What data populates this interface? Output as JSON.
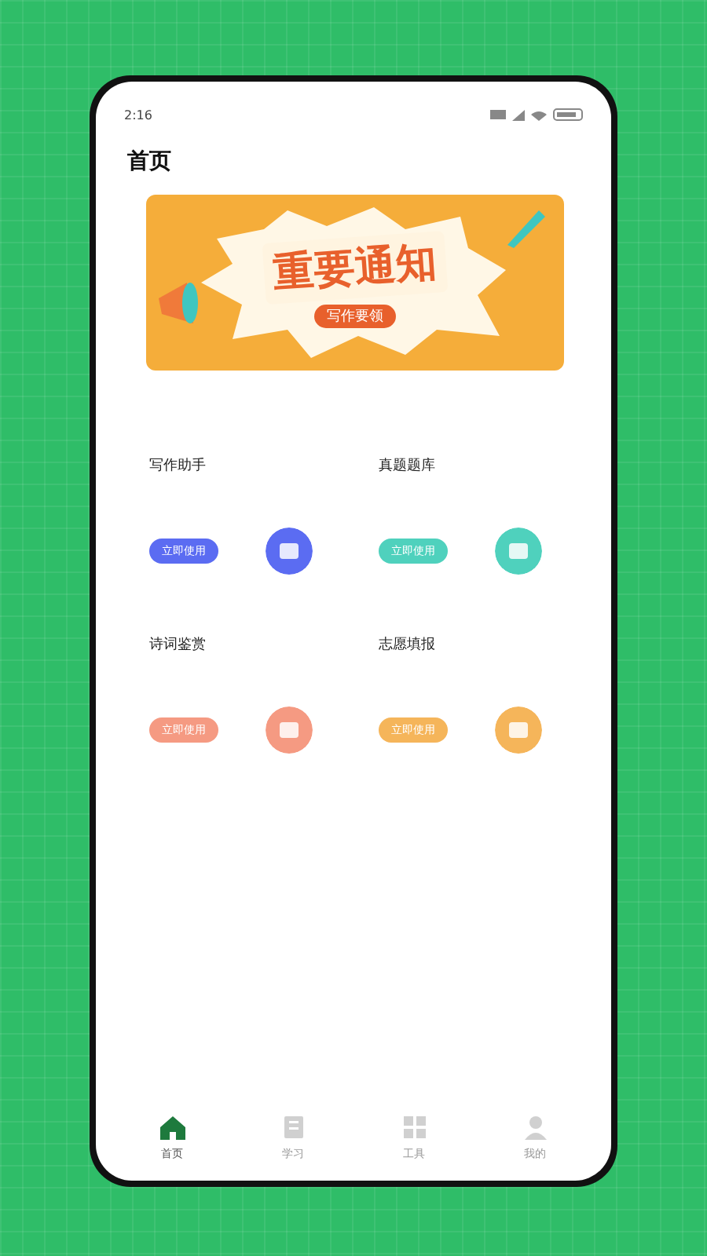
{
  "status_bar": {
    "time": "2:16"
  },
  "page": {
    "title": "首页"
  },
  "banner": {
    "headline": "重要通知",
    "subtitle": "写作要领"
  },
  "tools": [
    {
      "title": "写作助手",
      "action": "立即使用",
      "color": "#5b6cf2"
    },
    {
      "title": "真题题库",
      "action": "立即使用",
      "color": "#4fd1bd"
    },
    {
      "title": "诗词鉴赏",
      "action": "立即使用",
      "color": "#f59a82"
    },
    {
      "title": "志愿填报",
      "action": "立即使用",
      "color": "#f5b55a"
    }
  ],
  "tab_bar": [
    {
      "kind": "home",
      "label": "首页",
      "selected": true
    },
    {
      "kind": "study",
      "label": "学习",
      "selected": false
    },
    {
      "kind": "tools",
      "label": "工具",
      "selected": false
    },
    {
      "kind": "profile",
      "label": "我的",
      "selected": false
    }
  ]
}
